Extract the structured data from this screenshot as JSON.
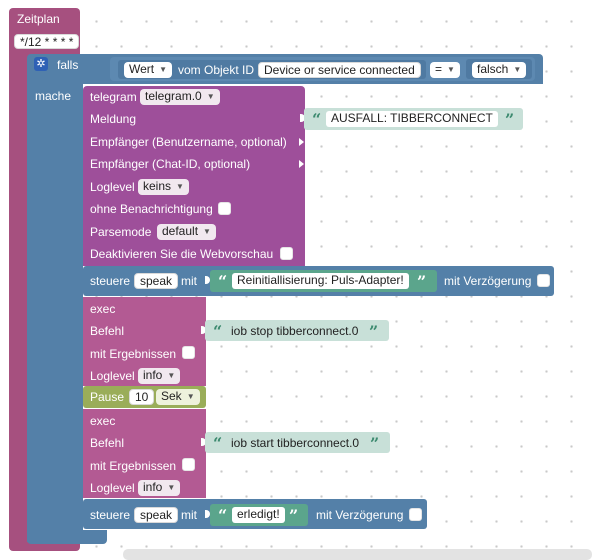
{
  "schedule": {
    "title": "Zeitplan",
    "cron": "*/12 * * * *"
  },
  "if_block": {
    "label": "falls",
    "do_label": "mache",
    "condition": {
      "value_dropdown": "Wert",
      "of_object_label": "vom Objekt ID",
      "object_id": "Device or service connected",
      "operator": "=",
      "compare_value": "falsch"
    }
  },
  "telegram": {
    "label": "telegram",
    "instance": "telegram.0",
    "message_label": "Meldung",
    "message_text": "AUSFALL: TIBBERCONNECT",
    "recipient_name_label": "Empfänger (Benutzername, optional)",
    "recipient_chat_label": "Empfänger (Chat-ID, optional)",
    "loglevel_label": "Loglevel",
    "loglevel_value": "keins",
    "silent_label": "ohne Benachrichtigung",
    "parsemode_label": "Parsemode",
    "parsemode_value": "default",
    "disable_preview_label": "Deaktivieren Sie die Webvorschau"
  },
  "control1": {
    "prefix": "steuere",
    "target": "speak",
    "with_label": "mit",
    "text": "Reinitiallisierung: Puls-Adapter!",
    "delay_label": "mit Verzögerung"
  },
  "exec1": {
    "label": "exec",
    "command_label": "Befehl",
    "command": "iob stop tibberconnect.0",
    "with_results_label": "mit Ergebnissen",
    "loglevel_label": "Loglevel",
    "loglevel_value": "info"
  },
  "pause": {
    "label": "Pause",
    "amount": "10",
    "unit": "Sek"
  },
  "exec2": {
    "label": "exec",
    "command_label": "Befehl",
    "command": "iob start tibberconnect.0",
    "with_results_label": "mit Ergebnissen",
    "loglevel_label": "Loglevel",
    "loglevel_value": "info"
  },
  "control2": {
    "prefix": "steuere",
    "target": "speak",
    "with_label": "mit",
    "text": "erledigt!",
    "delay_label": "mit Verzögerung"
  },
  "colors": {
    "schedule": "#a6507f",
    "logic": "#5480a8",
    "telegram": "#9e4f9a",
    "pause": "#9aad59",
    "text": "#c8e0d8",
    "text_green": "#5ba58c"
  }
}
